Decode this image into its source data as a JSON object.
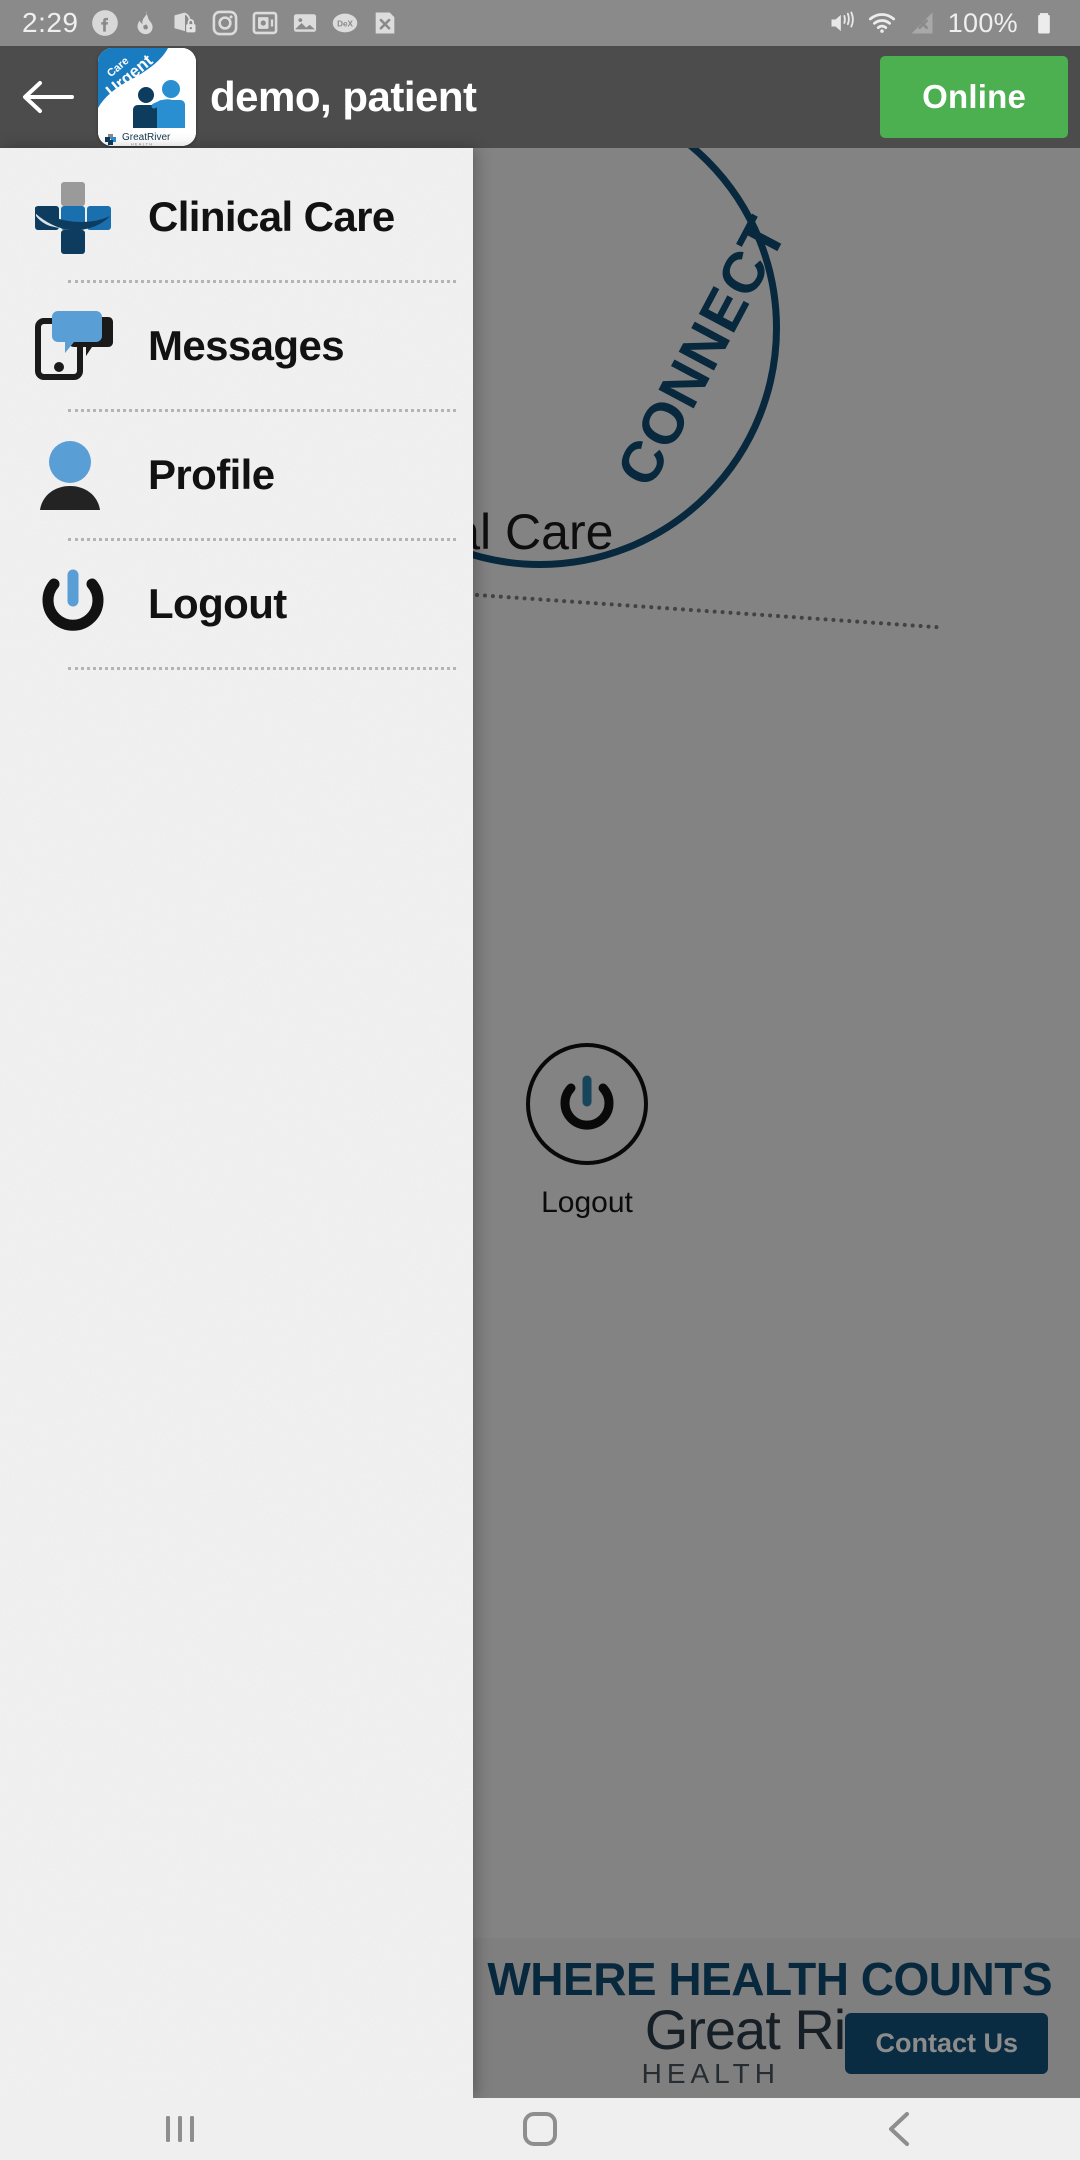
{
  "status_bar": {
    "time": "2:29",
    "battery_percent": "100%",
    "icons": [
      "facebook-icon",
      "flame-icon",
      "lock-notification-icon",
      "instagram-icon",
      "safe-icon",
      "gallery-icon",
      "dex-icon",
      "close-app-icon"
    ],
    "right_icons": [
      "mute-vibrate-icon",
      "wifi-icon",
      "cellular-off-icon",
      "battery-icon"
    ],
    "dex_label": "DeX",
    "background": "#8a8a8a"
  },
  "app_bar": {
    "back_label": "back-arrow",
    "title": "demo, patient",
    "online_label": "Online",
    "online_color": "#4caf50",
    "background": "#4c4c4c",
    "logo": {
      "line1": "Care",
      "line2": "Urgent",
      "brand": "Great River",
      "brand_sub": "HEALTH"
    }
  },
  "drawer": {
    "items": [
      {
        "label": "Clinical Care",
        "icon": "medical-cross-icon"
      },
      {
        "label": "Messages",
        "icon": "phone-chat-icon"
      },
      {
        "label": "Profile",
        "icon": "person-icon"
      },
      {
        "label": "Logout",
        "icon": "power-icon"
      }
    ],
    "background": "#f2f2f2"
  },
  "background_screen": {
    "circle_text": "CONNECT",
    "heading": "Clinical Care",
    "logout_label": "Logout",
    "footer_line1": "WHERE HEALTH COUNTS",
    "footer_line2": "Great River",
    "footer_line3": "HEALTH",
    "contact_us_label": "Contact Us",
    "brand_blue": "#0d4a70"
  },
  "bottom_nav": {
    "items": [
      "recents-icon",
      "home-icon",
      "back-icon"
    ],
    "background": "#efefef"
  }
}
